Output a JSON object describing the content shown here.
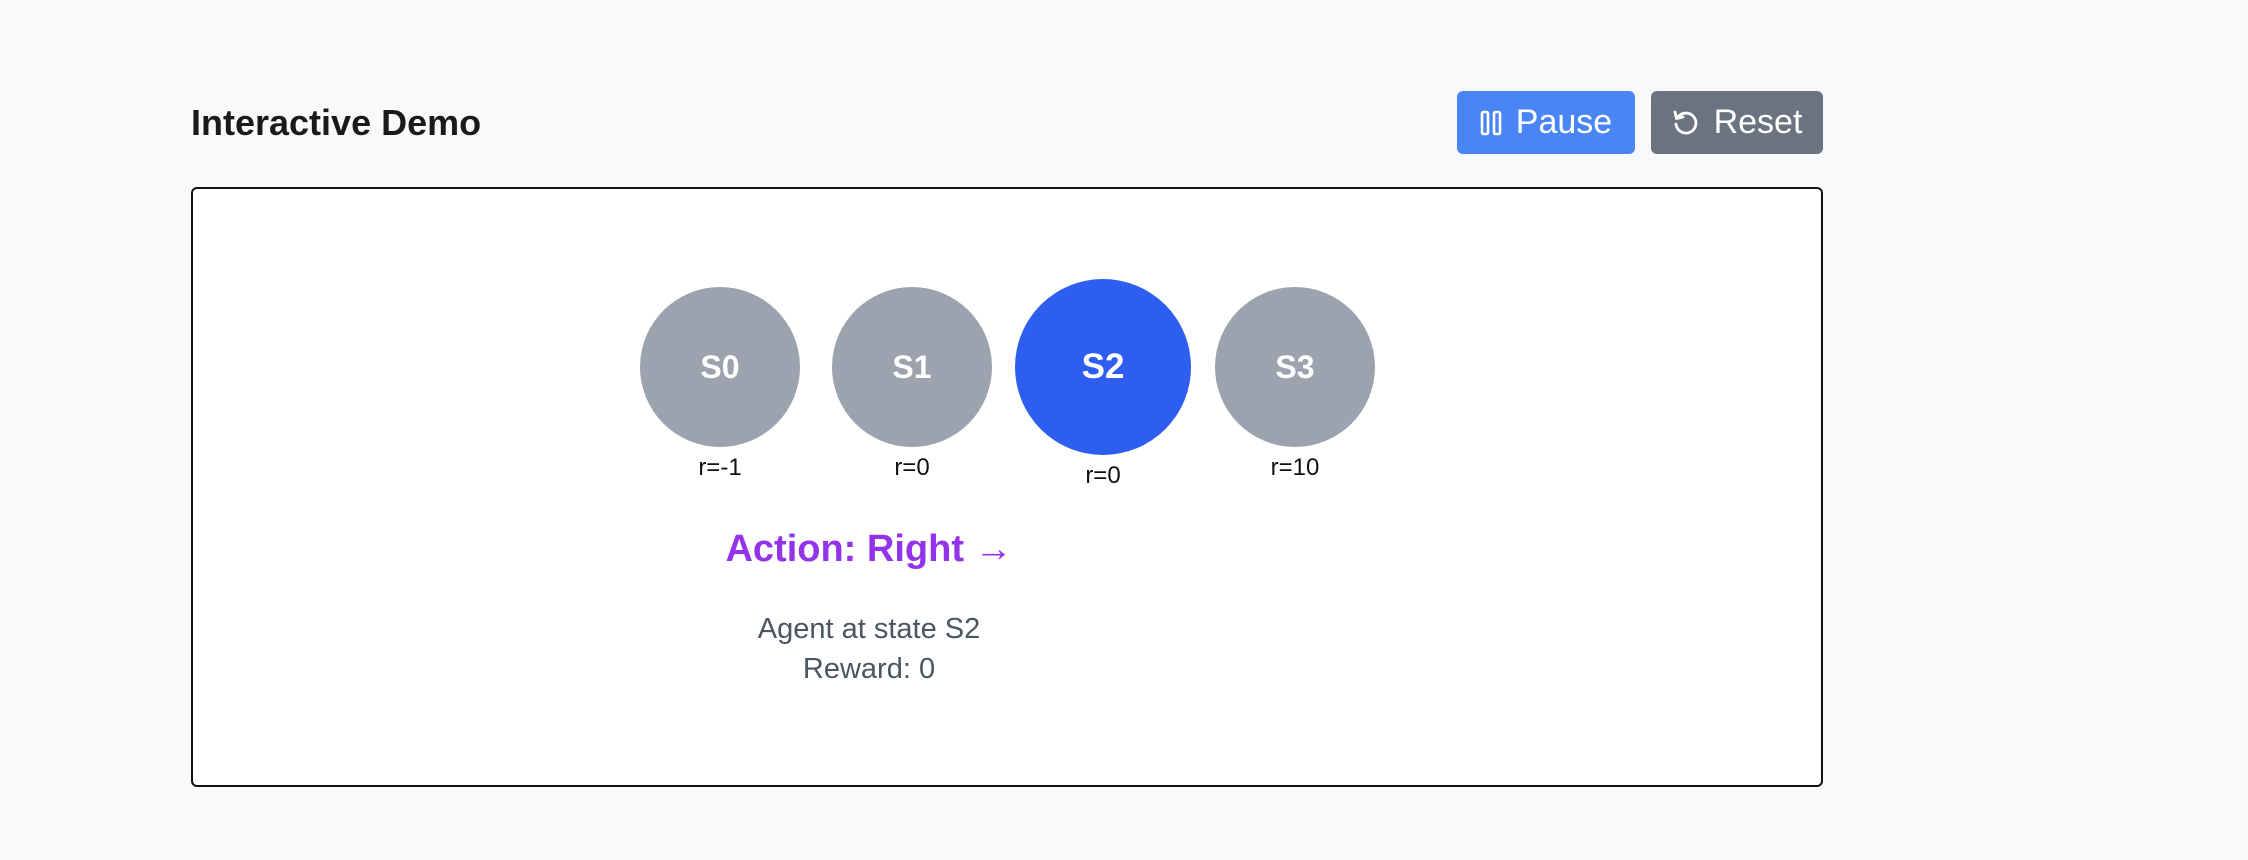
{
  "header": {
    "title": "Interactive Demo"
  },
  "controls": {
    "pause_label": "Pause",
    "reset_label": "Reset",
    "pause_icon": "pause-icon",
    "reset_icon": "reset-icon"
  },
  "states": [
    {
      "name": "S0",
      "reward_label": "r=-1",
      "active": false
    },
    {
      "name": "S1",
      "reward_label": "r=0",
      "active": false
    },
    {
      "name": "S2",
      "reward_label": "r=0",
      "active": true
    },
    {
      "name": "S3",
      "reward_label": "r=10",
      "active": false
    }
  ],
  "action": {
    "text": "Action: Right →"
  },
  "status": {
    "agent_text": "Agent at state S2",
    "reward_text": "Reward: 0"
  },
  "colors": {
    "state_inactive": "#9ca3af",
    "state_active": "#2e5ef0",
    "action_text": "#9333ea",
    "pause_button": "#4a85f6",
    "reset_button": "#6b7280"
  }
}
